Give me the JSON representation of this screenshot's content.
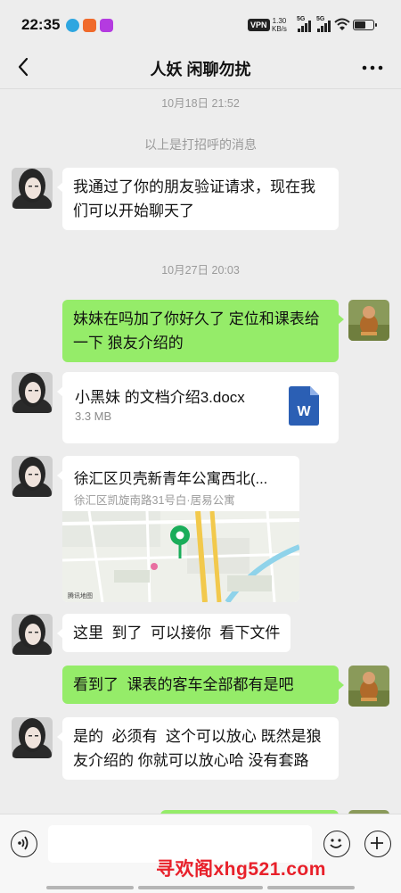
{
  "status_bar": {
    "time": "22:35",
    "vpn": "VPN",
    "net_speed_value": "1.30",
    "net_speed_unit": "KB/s",
    "signal_1": "5G",
    "signal_2": "5G"
  },
  "header": {
    "title": "人妖 闲聊勿扰"
  },
  "chat": {
    "timestamp_1": "10月18日 21:52",
    "system_note": "以上是打招呼的消息",
    "msg_1": "我通过了你的朋友验证请求，现在我们可以开始聊天了",
    "timestamp_2": "10月27日 20:03",
    "msg_2": "妹妹在吗加了你好久了  定位和课表给一下 狼友介绍的",
    "file": {
      "name": "小黑妹 的文档介绍3.docx",
      "size": "3.3 MB",
      "icon_letter": "W"
    },
    "location": {
      "title": "徐汇区贝壳新青年公寓西北(...",
      "address": "徐汇区凯旋南路31号白·居易公寓",
      "map_credit": "腾讯地图"
    },
    "msg_3": "这里  到了  可以接你  看下文件",
    "msg_4": "看到了  课表的客车全部都有是吧",
    "msg_5": "是的  必须有  这个可以放心 既然是狼友介绍的 你就可以放心哈 没有套路"
  },
  "input_bar": {
    "placeholder": ""
  },
  "watermark": "寻欢阁xhg521.com",
  "colors": {
    "background": "#ededed",
    "sent_bubble": "#95ec69",
    "received_bubble": "#ffffff",
    "watermark": "#e8202a",
    "word_blue": "#2b5fb4",
    "map_pin": "#1aad5a"
  },
  "icons": [
    "back-chevron-icon",
    "more-dots-icon",
    "voice-icon",
    "emoji-icon",
    "plus-icon",
    "word-doc-icon",
    "map-pin-icon"
  ]
}
